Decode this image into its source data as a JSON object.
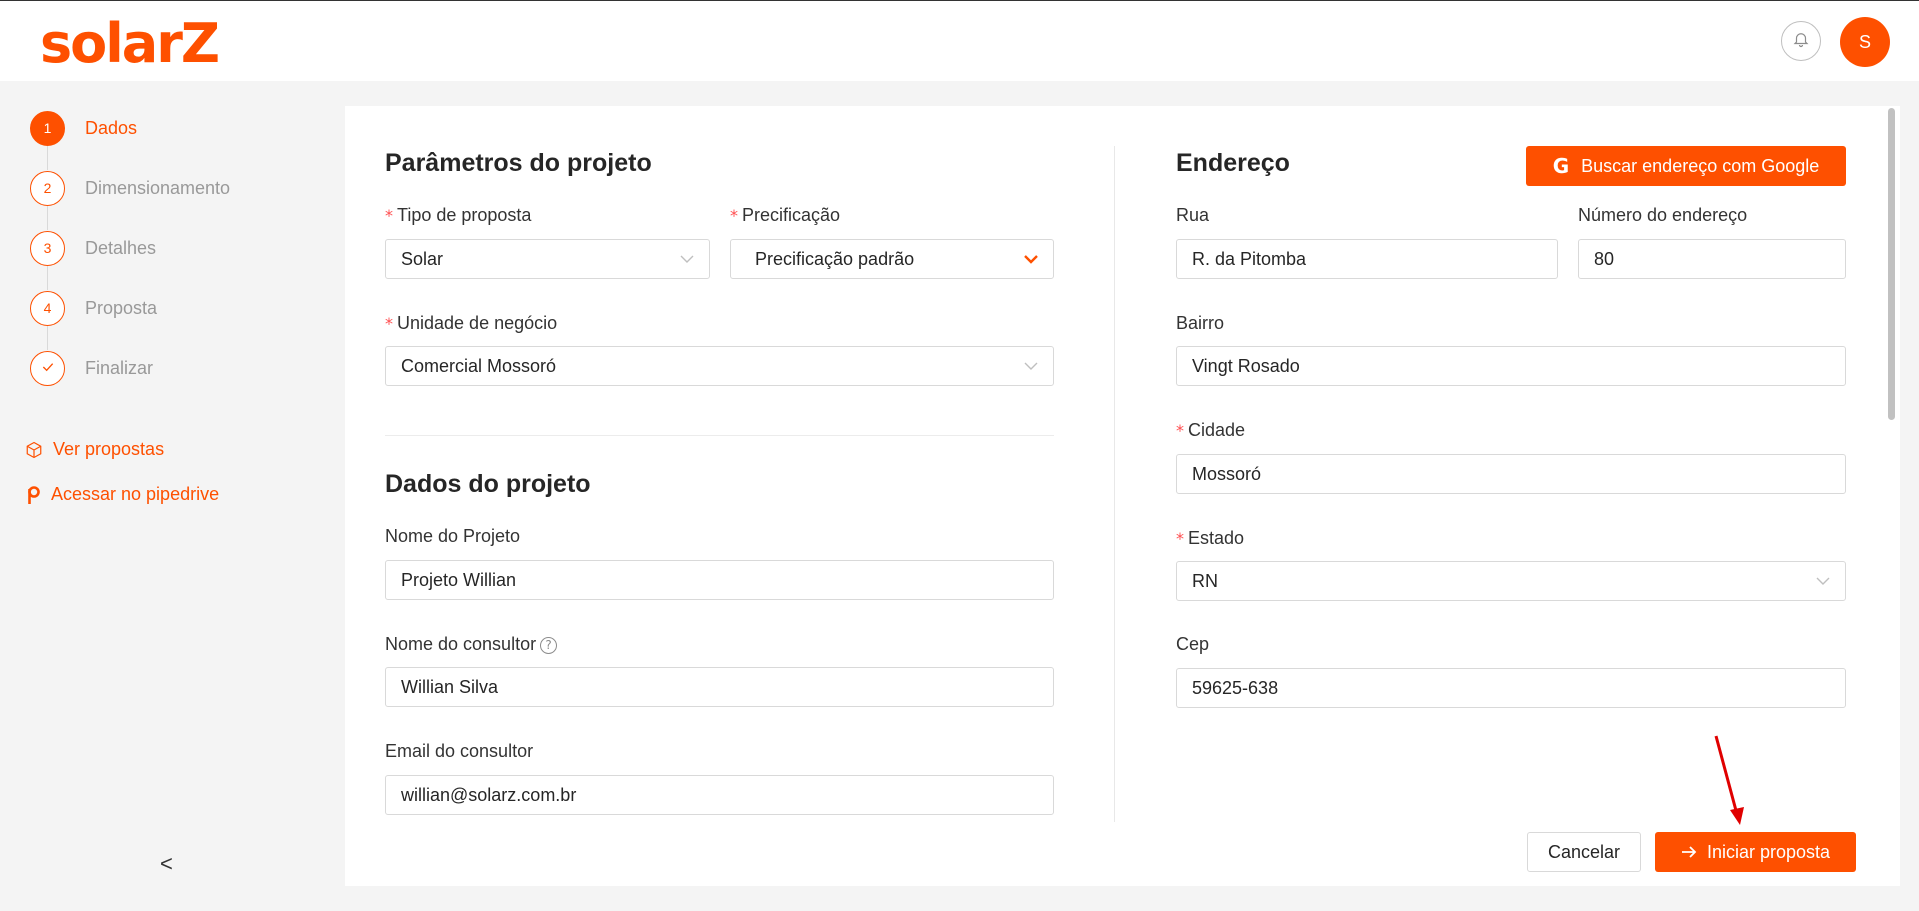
{
  "header": {
    "logo": "solarZ",
    "avatar_initial": "S",
    "icons": {
      "notifications": "bell-icon"
    }
  },
  "steps": [
    {
      "number": "1",
      "label": "Dados",
      "active": true
    },
    {
      "number": "2",
      "label": "Dimensionamento",
      "active": false
    },
    {
      "number": "3",
      "label": "Detalhes",
      "active": false
    },
    {
      "number": "4",
      "label": "Proposta",
      "active": false
    },
    {
      "number": "",
      "label": "Finalizar",
      "active": false,
      "icon": "check-icon"
    }
  ],
  "sidebar_links": {
    "proposals": {
      "label": "Ver propostas",
      "icon": "box-icon"
    },
    "pipedrive": {
      "label": "Acessar no pipedrive",
      "icon": "pipedrive-icon"
    },
    "collapse": "<"
  },
  "project_params": {
    "title": "Parâmetros do projeto",
    "proposal_type": {
      "label": "Tipo de proposta",
      "value": "Solar"
    },
    "pricing": {
      "label": "Precificação",
      "value": "Precificação padrão"
    },
    "business_unit": {
      "label": "Unidade de negócio",
      "value": "Comercial Mossoró"
    }
  },
  "project_data": {
    "title": "Dados do projeto",
    "project_name": {
      "label": "Nome do Projeto",
      "value": "Projeto Willian"
    },
    "consultant_name": {
      "label": "Nome do consultor",
      "value": "Willian Silva",
      "help": "?"
    },
    "consultant_email": {
      "label": "Email do consultor",
      "value": "willian@solarz.com.br"
    }
  },
  "address": {
    "title": "Endereço",
    "google_button": "Buscar endereço com Google",
    "google_glyph": "G",
    "street": {
      "label": "Rua",
      "value": "R. da Pitomba"
    },
    "number": {
      "label": "Número do endereço",
      "value": "80"
    },
    "neighborhood": {
      "label": "Bairro",
      "value": "Vingt Rosado"
    },
    "city": {
      "label": "Cidade",
      "value": "Mossoró"
    },
    "state": {
      "label": "Estado",
      "value": "RN"
    },
    "zip": {
      "label": "Cep",
      "value": "59625-638"
    }
  },
  "footer": {
    "cancel": "Cancelar",
    "start": "Iniciar proposta"
  },
  "colors": {
    "brand": "#fe5000",
    "required": "#ff4d4f",
    "annotation_arrow": "#e00000"
  }
}
